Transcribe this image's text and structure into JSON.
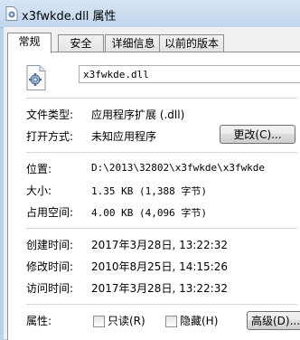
{
  "window": {
    "title": "x3fwkde.dll 属性"
  },
  "tabs": [
    {
      "label": "常规",
      "active": true
    },
    {
      "label": "安全",
      "active": false
    },
    {
      "label": "详细信息",
      "active": false
    },
    {
      "label": "以前的版本",
      "active": false
    }
  ],
  "file": {
    "name": "x3fwkde.dll"
  },
  "fields": {
    "type_label": "文件类型:",
    "type_value": "应用程序扩展 (.dll)",
    "opens_label": "打开方式:",
    "opens_value": "未知应用程序",
    "change_button": "更改(C)...",
    "location_label": "位置:",
    "location_value": "D:\\2013\\32802\\x3fwkde\\x3fwkde",
    "size_label": "大小:",
    "size_value": "1.35 KB (1,388 字节)",
    "disk_label": "占用空间:",
    "disk_value": "4.00 KB (4,096 字节)",
    "created_label": "创建时间:",
    "created_value": "2017年3月28日, 13:22:32",
    "modified_label": "修改时间:",
    "modified_value": "2010年8月25日, 14:15:26",
    "accessed_label": "访问时间:",
    "accessed_value": "2017年3月28日, 13:22:32",
    "attributes_label": "属性:",
    "readonly_label": "只读(R)",
    "readonly_checked": false,
    "hidden_label": "隐藏(H)",
    "hidden_checked": false,
    "advanced_button": "高级(D)..."
  },
  "icons": {
    "title": "dll-file-icon",
    "file": "dll-gear-file-icon"
  },
  "colors": {
    "title_bar": "#c8dbef",
    "panel": "#ffffff",
    "client": "#f0f0f0"
  }
}
